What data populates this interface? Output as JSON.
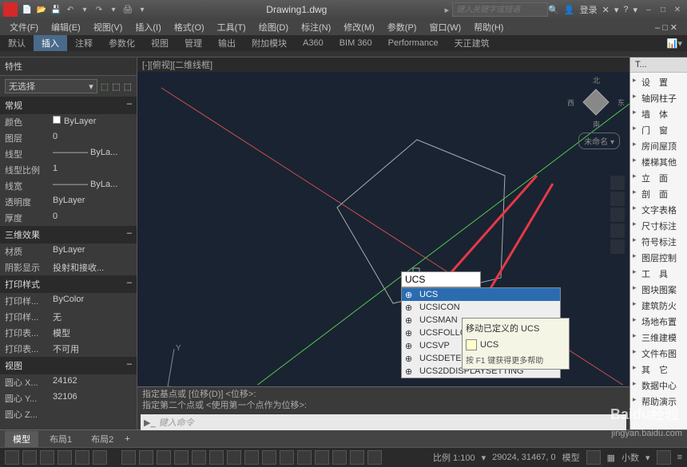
{
  "title_doc": "Drawing1.dwg",
  "search_placeholder": "键入关键字或短语",
  "login": "登录",
  "menubar": [
    "文件(F)",
    "编辑(E)",
    "视图(V)",
    "插入(I)",
    "格式(O)",
    "工具(T)",
    "绘图(D)",
    "标注(N)",
    "修改(M)",
    "参数(P)",
    "窗口(W)",
    "帮助(H)"
  ],
  "ribbon": [
    "默认",
    "插入",
    "注释",
    "参数化",
    "视图",
    "管理",
    "输出",
    "附加模块",
    "A360",
    "BIM 360",
    "Performance",
    "天正建筑"
  ],
  "properties": {
    "title": "特性",
    "selection": "无选择",
    "sections": [
      {
        "name": "常规",
        "rows": [
          {
            "label": "颜色",
            "value": "ByLayer",
            "swatch": true
          },
          {
            "label": "图层",
            "value": "0"
          },
          {
            "label": "线型",
            "value": "———— ByLa..."
          },
          {
            "label": "线型比例",
            "value": "1"
          },
          {
            "label": "线宽",
            "value": "———— ByLa..."
          },
          {
            "label": "透明度",
            "value": "ByLayer"
          },
          {
            "label": "厚度",
            "value": "0"
          }
        ]
      },
      {
        "name": "三维效果",
        "rows": [
          {
            "label": "材质",
            "value": "ByLayer"
          },
          {
            "label": "阴影显示",
            "value": "投射和接收..."
          }
        ]
      },
      {
        "name": "打印样式",
        "rows": [
          {
            "label": "打印样...",
            "value": "ByColor"
          },
          {
            "label": "打印样...",
            "value": "无"
          },
          {
            "label": "打印表...",
            "value": "模型"
          },
          {
            "label": "打印表...",
            "value": "不可用"
          }
        ]
      },
      {
        "name": "视图",
        "rows": [
          {
            "label": "圆心 X...",
            "value": "24162"
          },
          {
            "label": "圆心 Y...",
            "value": "32106"
          },
          {
            "label": "圆心 Z...",
            "value": ""
          }
        ]
      }
    ]
  },
  "canvas": {
    "view_label": "[-][俯视][二维线框]",
    "compass": {
      "n": "北",
      "s": "南",
      "e": "东",
      "w": "西"
    },
    "unnamed": "未命名 ▾"
  },
  "autocomplete": {
    "typed": "UCS",
    "items": [
      "UCS",
      "UCSICON",
      "UCSMAN",
      "UCSFOLLOW",
      "UCSVP",
      "UCSDETECT",
      "UCS2DDISPLAYSETTING"
    ]
  },
  "tooltip": {
    "title": "移动已定义的 UCS",
    "ucs_label": "UCS",
    "help": "按 F1 键获得更多帮助"
  },
  "cmd": {
    "hist1": "指定基点或 [位移(D)] <位移>:",
    "hist2": "指定第二个点或 <使用第一个点作为位移>:",
    "prompt": "键入命令"
  },
  "right_panel": {
    "tab": "T...",
    "items": [
      "设　置",
      "轴网柱子",
      "墙　体",
      "门　窗",
      "房间屋顶",
      "楼梯其他",
      "立　面",
      "剖　面",
      "文字表格",
      "尺寸标注",
      "符号标注",
      "图层控制",
      "工　具",
      "图块图案",
      "建筑防火",
      "场地布置",
      "三维建模",
      "文件布图",
      "其　它",
      "数据中心",
      "帮助演示"
    ]
  },
  "bottom_tabs": [
    "模型",
    "布局1",
    "布局2"
  ],
  "status": {
    "scale": "比例 1:100",
    "coords": "29024, 31467, 0",
    "space": "模型",
    "decimal": "小数"
  },
  "watermark": "jingyan.baidu.com",
  "bdlogo": "Baidu经验"
}
